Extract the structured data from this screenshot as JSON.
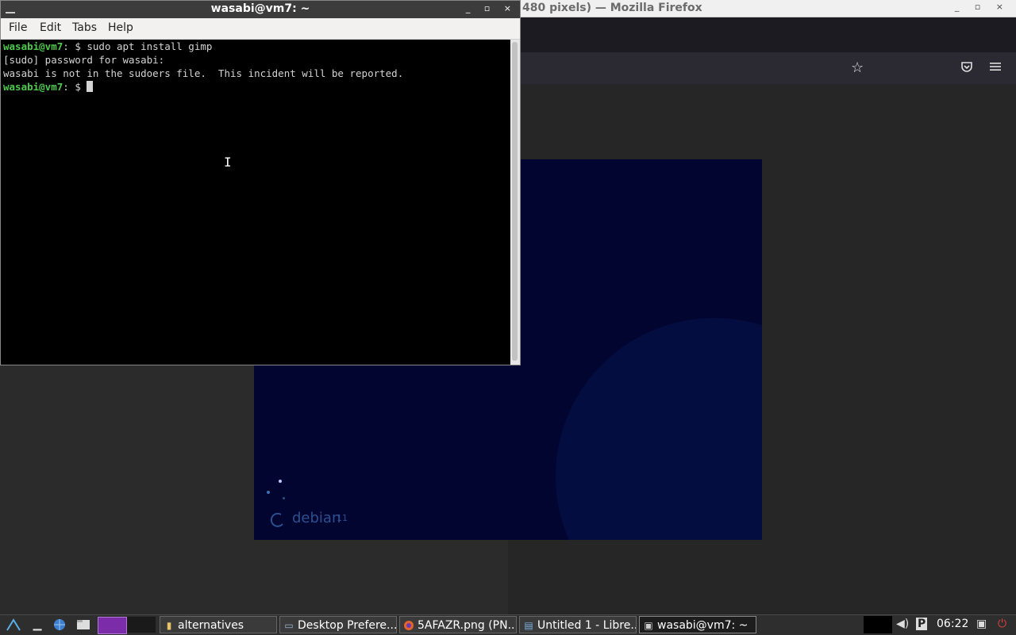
{
  "firefox": {
    "title": "480 pixels) — Mozilla Firefox",
    "controls": "_ ▫ ×",
    "bookmark_icon": "star-icon",
    "pocket_icon": "pocket-icon",
    "menu_icon": "hamburger-menu-icon"
  },
  "debian": {
    "brand": "debian",
    "version": "11",
    "bg_color": "#020530"
  },
  "terminal": {
    "title": "wasabi@vm7: ~",
    "controls": "_ ▫ ×",
    "menu": [
      "File",
      "Edit",
      "Tabs",
      "Help"
    ],
    "lines": [
      {
        "prompt_user": "wasabi@vm7",
        "prompt_rest": ": $ ",
        "text": "sudo apt install gimp"
      },
      {
        "text": "[sudo] password for wasabi:"
      },
      {
        "text": "wasabi is not in the sudoers file.  This incident will be reported."
      },
      {
        "prompt_user": "wasabi@vm7",
        "prompt_rest": ": $ ",
        "text": ""
      }
    ],
    "prompt_color": "#4ec94e"
  },
  "taskbar": {
    "launchers": [
      "start-menu-icon",
      "show-desktop-icon",
      "web-browser-icon",
      "file-manager-icon",
      "workspace-switcher-icon"
    ],
    "tasks": [
      {
        "label": "alternatives",
        "icon": "folder-icon"
      },
      {
        "label": "Desktop Prefere...",
        "icon": "window-icon"
      },
      {
        "label": "5AFAZR.png (PN...",
        "icon": "firefox-icon"
      },
      {
        "label": "Untitled 1 - Libre...",
        "icon": "document-icon"
      },
      {
        "label": "wasabi@vm7: ~",
        "icon": "terminal-icon"
      }
    ],
    "clock": "06:22"
  }
}
